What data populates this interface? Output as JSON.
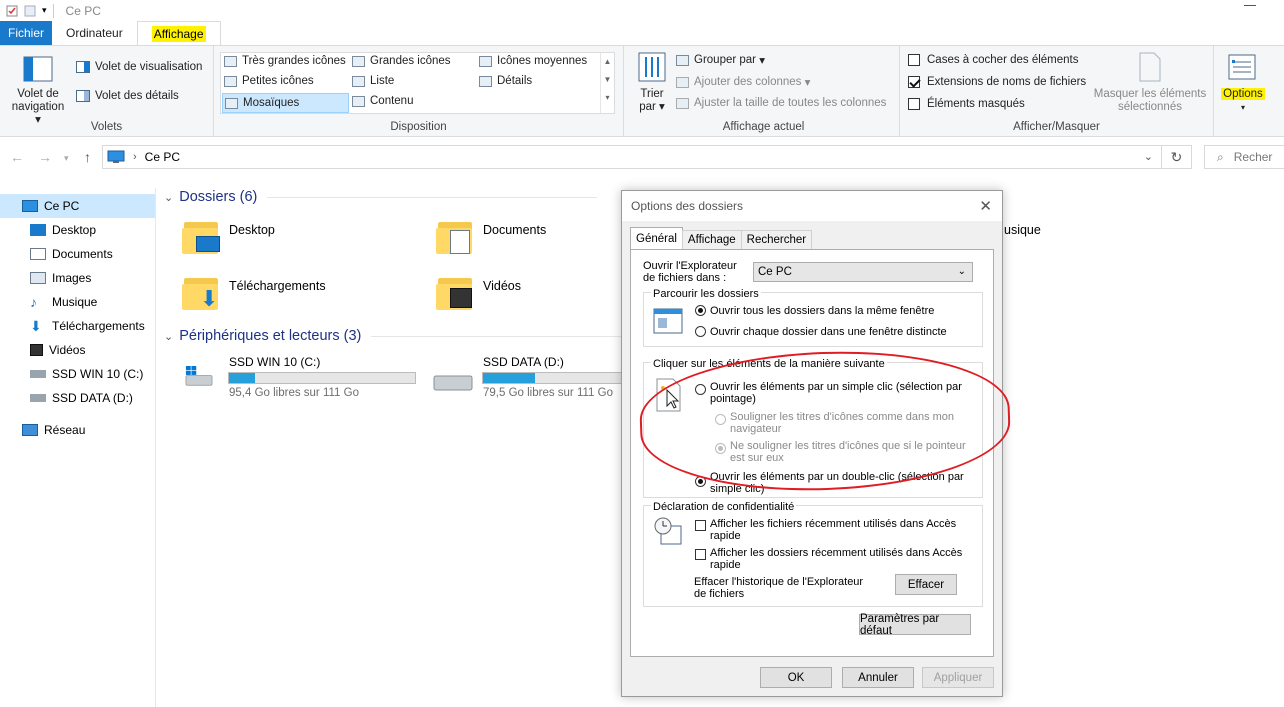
{
  "window": {
    "title": "Ce PC"
  },
  "tabs": {
    "fichier": "Fichier",
    "ordinateur": "Ordinateur",
    "affichage": "Affichage"
  },
  "ribbon": {
    "volets": {
      "nav_label_1": "Volet de",
      "nav_label_2": "navigation",
      "visualisation": "Volet de visualisation",
      "details": "Volet des détails",
      "group": "Volets"
    },
    "disposition": {
      "items": [
        "Très grandes icônes",
        "Grandes icônes",
        "Icônes moyennes",
        "Petites icônes",
        "Liste",
        "Détails",
        "Mosaïques",
        "Contenu"
      ],
      "group": "Disposition"
    },
    "affichage_actuel": {
      "trier_1": "Trier",
      "trier_2": "par",
      "grouper": "Grouper par",
      "ajouter_colonnes": "Ajouter des colonnes",
      "ajuster": "Ajuster la taille de toutes les colonnes",
      "group": "Affichage actuel"
    },
    "afficher_masquer": {
      "cases": "Cases à cocher des éléments",
      "extensions": "Extensions de noms de fichiers",
      "masques": "Éléments masqués",
      "masquer_1": "Masquer les éléments",
      "masquer_2": "sélectionnés",
      "options": "Options",
      "group": "Afficher/Masquer"
    }
  },
  "address": {
    "path": "Ce PC",
    "search_placeholder": "Recher"
  },
  "sidebar": {
    "items": [
      "Ce PC",
      "Desktop",
      "Documents",
      "Images",
      "Musique",
      "Téléchargements",
      "Vidéos",
      "SSD WIN 10 (C:)",
      "SSD DATA (D:)",
      "Réseau"
    ]
  },
  "content": {
    "dossiers_header": "Dossiers (6)",
    "folders": [
      "Desktop",
      "Documents",
      "Téléchargements",
      "Vidéos",
      "usique"
    ],
    "devices_header": "Périphériques et lecteurs (3)",
    "drives": [
      {
        "name": "SSD WIN 10 (C:)",
        "free": "95,4 Go libres sur 111 Go",
        "used_fraction": 0.14
      },
      {
        "name": "SSD DATA (D:)",
        "free": "79,5 Go libres sur 111 Go",
        "used_fraction": 0.28
      }
    ]
  },
  "dialog": {
    "title": "Options des dossiers",
    "tabs": [
      "Général",
      "Affichage",
      "Rechercher"
    ],
    "open_label_1": "Ouvrir l'Explorateur",
    "open_label_2": "de fichiers dans :",
    "open_value": "Ce PC",
    "browse_title": "Parcourir les dossiers",
    "browse_same": "Ouvrir tous les dossiers dans la même fenêtre",
    "browse_distinct": "Ouvrir chaque dossier dans une fenêtre distincte",
    "click_title": "Cliquer sur les éléments de la manière suivante",
    "single_1": "Ouvrir les éléments par un simple clic (sélection par",
    "single_2": "pointage)",
    "underline_always_1": "Souligner les titres d'icônes comme dans mon",
    "underline_always_2": "navigateur",
    "underline_hover_1": "Ne souligner les titres d'icônes que si le pointeur",
    "underline_hover_2": "est sur eux",
    "double_1": "Ouvrir les éléments par un double-clic (sélection par",
    "double_2": "simple clic)",
    "privacy_title": "Déclaration de confidentialité",
    "recent_files_1": "Afficher les fichiers récemment utilisés dans Accès",
    "recent_files_2": "rapide",
    "recent_folders_1": "Afficher les dossiers récemment utilisés dans Accès",
    "recent_folders_2": "rapide",
    "clear_history_1": "Effacer l'historique de l'Explorateur",
    "clear_history_2": "de fichiers",
    "clear_button": "Effacer",
    "defaults_button": "Paramètres par défaut",
    "ok": "OK",
    "cancel": "Annuler",
    "apply": "Appliquer"
  },
  "colors": {
    "accent": "#1979ca",
    "highlight": "#fff200",
    "annotation": "#e01c24",
    "progress": "#26a0da"
  }
}
